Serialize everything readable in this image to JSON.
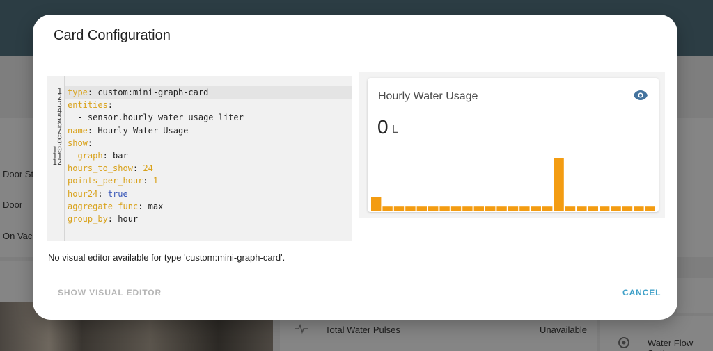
{
  "background": {
    "labels": [
      "Door St",
      "Door",
      "On Vaca"
    ],
    "row_entity": "Total Water Pulses",
    "row_value": "Unavailable",
    "right_entity": "Water Flow Switc"
  },
  "dialog": {
    "title": "Card Configuration",
    "yaml_lines": [
      {
        "key": "type",
        "value": "custom:mini-graph-card"
      },
      {
        "key": "entities",
        "value": ""
      },
      {
        "raw": "  - sensor.hourly_water_usage_liter"
      },
      {
        "key": "name",
        "value": "Hourly Water Usage"
      },
      {
        "key": "show",
        "value": ""
      },
      {
        "indent": "  ",
        "key": "graph",
        "value": "bar"
      },
      {
        "key": "hours_to_show",
        "value": "24",
        "num": true
      },
      {
        "key": "points_per_hour",
        "value": "1",
        "num": true
      },
      {
        "key": "hour24",
        "value": "true",
        "bool": true
      },
      {
        "key": "aggregate_func",
        "value": "max"
      },
      {
        "key": "group_by",
        "value": "hour"
      }
    ],
    "line_numbers": [
      "1",
      "2",
      "3",
      "4",
      "5",
      "6",
      "7",
      "8",
      "9",
      "10",
      "11",
      "12"
    ],
    "no_editor_message": "No visual editor available for type 'custom:mini-graph-card'.",
    "show_visual_editor_label": "SHOW VISUAL EDITOR",
    "cancel_label": "CANCEL"
  },
  "preview": {
    "name": "Hourly Water Usage",
    "state": "0",
    "unit": "L",
    "icon": "eye-icon"
  },
  "chart_data": {
    "type": "bar",
    "title": "",
    "series": [
      {
        "values": [
          0.27,
          0.09,
          0.09,
          0.09,
          0.09,
          0.09,
          0.09,
          0.09,
          0.09,
          0.09,
          0.09,
          0.09,
          0.09,
          0.09,
          0.09,
          0.09,
          1.0,
          0.09,
          0.09,
          0.09,
          0.09,
          0.09,
          0.09,
          0.09,
          0.09
        ]
      }
    ],
    "color": "#f39c12",
    "ylim": [
      0,
      1
    ]
  },
  "colors": {
    "accent": "#3fa0c8",
    "bar": "#f39c12",
    "header": "#2c3d44"
  }
}
